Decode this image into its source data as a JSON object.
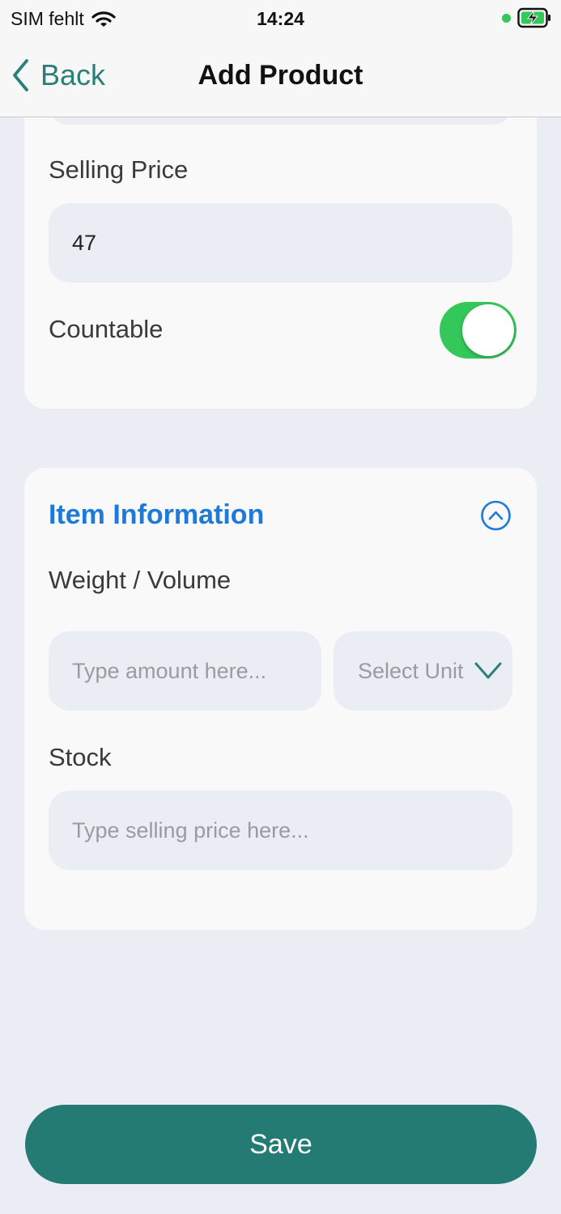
{
  "status_bar": {
    "carrier": "SIM fehlt",
    "time": "14:24"
  },
  "nav": {
    "back_label": "Back",
    "title": "Add Product"
  },
  "pricing": {
    "selling_price_label": "Selling Price",
    "selling_price_value": "47",
    "countable_label": "Countable",
    "countable_on": true
  },
  "item_info": {
    "title": "Item Information",
    "weight_label": "Weight / Volume",
    "amount_placeholder": "Type amount here...",
    "unit_placeholder": "Select Unit",
    "stock_label": "Stock",
    "stock_placeholder": "Type selling price here..."
  },
  "save_label": "Save",
  "colors": {
    "accent": "#237b74",
    "section_title": "#1e7ad9",
    "toggle_on": "#34c759",
    "background": "#ebedf5"
  }
}
